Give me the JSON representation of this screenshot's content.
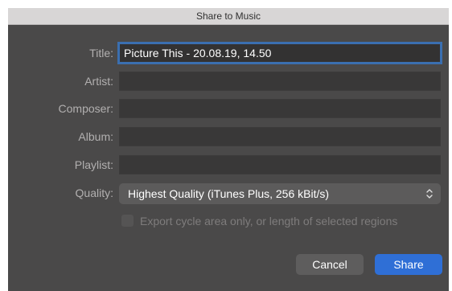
{
  "window": {
    "title": "Share to Music"
  },
  "form": {
    "title_label": "Title:",
    "title_value": "Picture This - 20.08.19, 14.50",
    "artist_label": "Artist:",
    "artist_value": "",
    "composer_label": "Composer:",
    "composer_value": "",
    "album_label": "Album:",
    "album_value": "",
    "playlist_label": "Playlist:",
    "playlist_value": "",
    "quality_label": "Quality:",
    "quality_value": "Highest Quality (iTunes Plus, 256 kBit/s)",
    "export_cycle_label": "Export cycle area only, or length of selected regions",
    "export_cycle_checked": false
  },
  "buttons": {
    "cancel_label": "Cancel",
    "share_label": "Share"
  },
  "colors": {
    "accent": "#2f6fd6",
    "focus_ring": "#3b6fb0",
    "background": "#4a4949"
  },
  "icons": {
    "select_chevron": "chevron-up-down-icon"
  }
}
